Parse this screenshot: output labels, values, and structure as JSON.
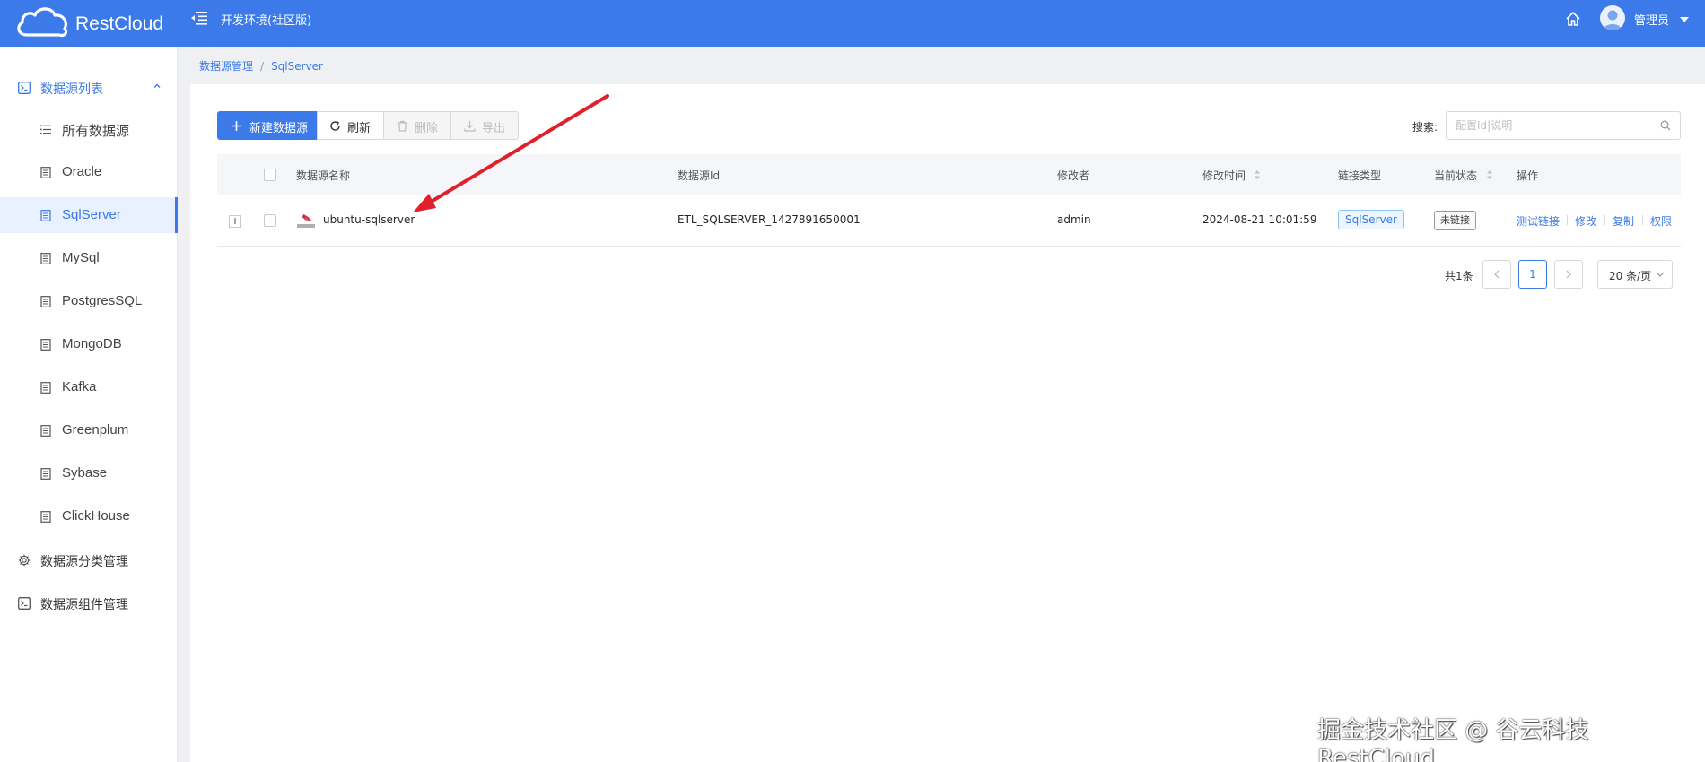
{
  "header": {
    "app_name": "RestCloud",
    "env_title": "开发环境(社区版)",
    "user_name": "管理员",
    "accent": "#3b7ae8"
  },
  "sidebar": {
    "group_list": "数据源列表",
    "items": [
      {
        "label": "所有数据源",
        "icon": "list-icon"
      },
      {
        "label": "Oracle",
        "icon": "doc-icon"
      },
      {
        "label": "SqlServer",
        "icon": "doc-icon",
        "active": true
      },
      {
        "label": "MySql",
        "icon": "doc-icon"
      },
      {
        "label": "PostgresSQL",
        "icon": "doc-icon"
      },
      {
        "label": "MongoDB",
        "icon": "doc-icon"
      },
      {
        "label": "Kafka",
        "icon": "doc-icon"
      },
      {
        "label": "Greenplum",
        "icon": "doc-icon"
      },
      {
        "label": "Sybase",
        "icon": "doc-icon"
      },
      {
        "label": "ClickHouse",
        "icon": "doc-icon"
      }
    ],
    "group_category": "数据源分类管理",
    "group_component": "数据源组件管理"
  },
  "breadcrumb": {
    "root": "数据源管理",
    "sep": "/",
    "current": "SqlServer"
  },
  "toolbar": {
    "new_label": "新建数据源",
    "refresh_label": "刷新",
    "delete_label": "删除",
    "export_label": "导出"
  },
  "search": {
    "label": "搜索:",
    "placeholder": "配置Id|说明",
    "value": ""
  },
  "table": {
    "headers": {
      "name": "数据源名称",
      "id": "数据源Id",
      "modifier": "修改者",
      "modified_time": "修改时间",
      "link_type": "链接类型",
      "status": "当前状态",
      "actions": "操作"
    },
    "rows": [
      {
        "expand": "+",
        "name": "ubuntu-sqlserver",
        "id": "ETL_SQLSERVER_1427891650001",
        "modifier": "admin",
        "modified_time": "2024-08-21 10:01:59",
        "link_type": "SqlServer",
        "status": "未链接",
        "actions": [
          "测试链接",
          "修改",
          "复制",
          "权限"
        ]
      }
    ]
  },
  "pagination": {
    "total": "共1条",
    "current_page": "1",
    "page_size": "20 条/页"
  },
  "watermark": "掘金技术社区 @ 谷云科技RestCloud"
}
